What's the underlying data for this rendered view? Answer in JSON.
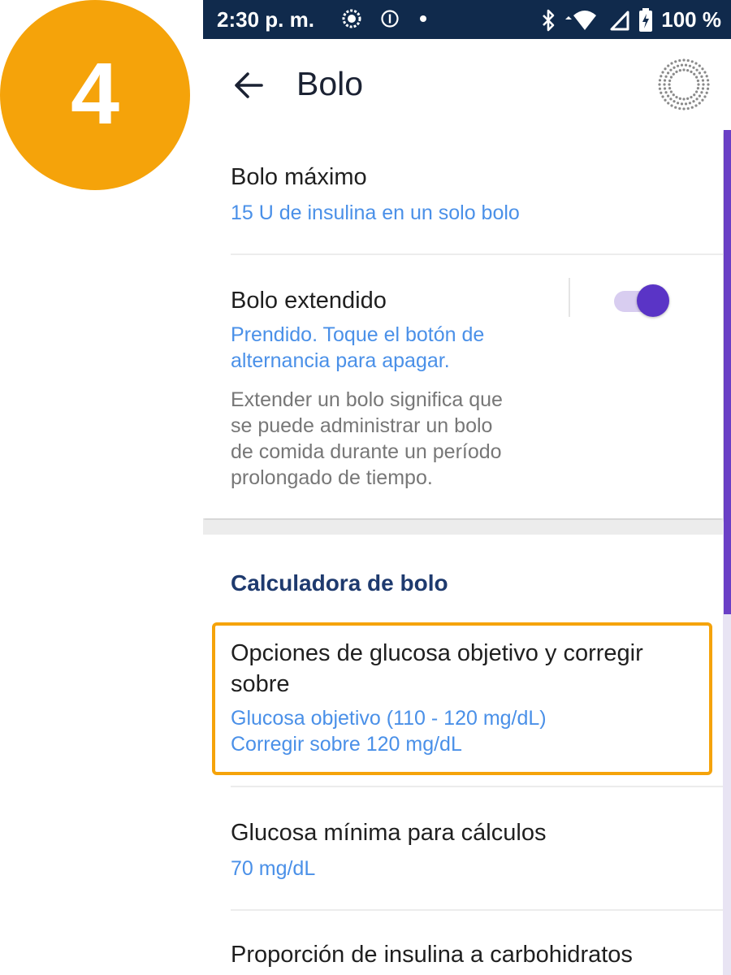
{
  "step_number": "4",
  "status_bar": {
    "time": "2:30 p. m.",
    "battery": "100 %",
    "icons": [
      "sync-icon",
      "info-circle-icon",
      "dot-icon",
      "bluetooth-icon",
      "wifi-icon",
      "signal-icon",
      "battery-charging-icon"
    ]
  },
  "app_bar": {
    "title": "Bolo",
    "back_icon": "arrow-left-icon",
    "pod_icon": "pod-status-icon"
  },
  "settings": {
    "max_bolus": {
      "title": "Bolo máximo",
      "value": "15 U de insulina en un solo bolo"
    },
    "extended_bolus": {
      "title": "Bolo extendido",
      "status_line1": "Prendido. Toque el botón de",
      "status_line2": "alternancia para apagar.",
      "desc_line1": "Extender un bolo significa que",
      "desc_line2": "se puede administrar un bolo",
      "desc_line3": "de comida durante un período",
      "desc_line4": "prolongado de tiempo.",
      "toggle_on": true
    }
  },
  "calculator": {
    "section_title": "Calculadora de bolo",
    "target_glucose": {
      "title_line1": "Opciones de glucosa objetivo y corregir",
      "title_line2": "sobre",
      "value_line1": "Glucosa objetivo (110 - 120 mg/dL)",
      "value_line2": "Corregir sobre 120 mg/dL"
    },
    "min_glucose": {
      "title": "Glucosa mínima para cálculos",
      "value": "70 mg/dL"
    },
    "ic_ratio": {
      "title": "Proporción de insulina a carbohidratos"
    }
  },
  "colors": {
    "accent": "#f5a30a",
    "status_bar": "#102a4c",
    "link_blue": "#4a90e8",
    "toggle_purple": "#5a34c6",
    "section_header": "#1e3a6e"
  }
}
